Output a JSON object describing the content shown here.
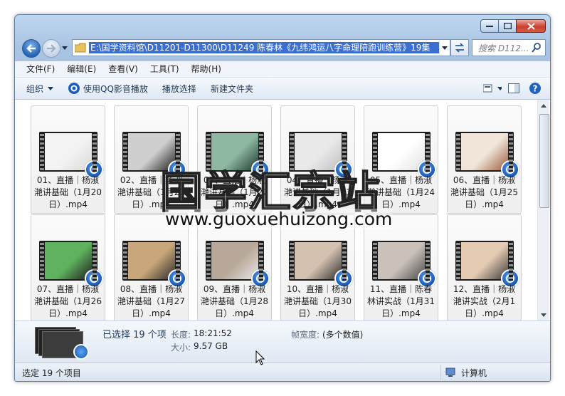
{
  "window": {
    "search_placeholder": "搜索 D112...",
    "address_path": "E:\\国学资料馆\\D11201-D11300\\D11249 陈春林《九纬鸿运八字命理陪跑训练营》19集"
  },
  "menu": [
    "文件(F)",
    "编辑(E)",
    "查看(V)",
    "工具(T)",
    "帮助(H)"
  ],
  "toolbar": {
    "organize": "组织",
    "qq_play": "使用QQ影音播放",
    "play_selection": "播放选择",
    "new_folder": "新建文件夹"
  },
  "files": [
    {
      "line1": "01、直播｜杨淑",
      "line2": "滟讲基础（1月20",
      "line3": "日）.mp4"
    },
    {
      "line1": "02、直播｜杨淑",
      "line2": "滟讲基础（1月21",
      "line3": "日）.mp4"
    },
    {
      "line1": "03、直播｜杨淑",
      "line2": "滟讲基础（1月22",
      "line3": "日）.mp4"
    },
    {
      "line1": "04、直播｜杨淑",
      "line2": "滟讲基础（1月23",
      "line3": "日）.mp4"
    },
    {
      "line1": "05、直播｜杨淑",
      "line2": "滟讲基础（1月24",
      "line3": "日）.mp4"
    },
    {
      "line1": "06、直播｜杨淑",
      "line2": "滟讲基础（1月25",
      "line3": "日）.mp4"
    },
    {
      "line1": "07、直播｜杨淑",
      "line2": "滟讲基础（1月26",
      "line3": "日）.mp4"
    },
    {
      "line1": "08、直播｜杨淑",
      "line2": "滟讲基础（1月27",
      "line3": "日）.mp4"
    },
    {
      "line1": "09、直播｜杨淑",
      "line2": "滟讲基础（1月28",
      "line3": "日）.mp4"
    },
    {
      "line1": "10、直播｜杨淑",
      "line2": "滟讲基础（1月30",
      "line3": "日）.mp4"
    },
    {
      "line1": "11、直播｜陈春",
      "line2": "林讲实战（1月31",
      "line3": "日）.mp4"
    },
    {
      "line1": "12、直播｜杨淑",
      "line2": "滟讲实战（2月1",
      "line3": "日）.mp4"
    }
  ],
  "details": {
    "selected": "已选择 19 个项",
    "length_key": "长度:",
    "length_val": "18:21:52",
    "size_key": "大小:",
    "size_val": "9.57 GB",
    "width_key": "帧宽度:",
    "width_val": "(多个数值)"
  },
  "status": {
    "left": "选定 19 个项目",
    "right": "计算机"
  },
  "watermark": {
    "cn": "国学汇宗站",
    "url": "www.guoxuehuizong.com"
  }
}
